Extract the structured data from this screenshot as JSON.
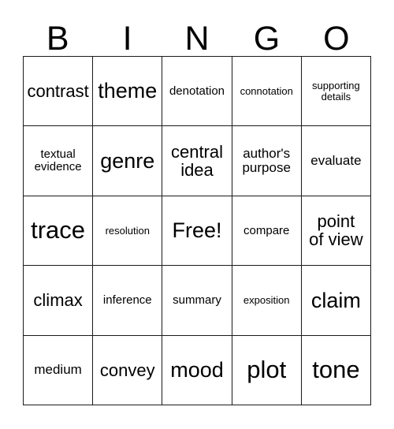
{
  "card": {
    "title": "BINGO",
    "header_letters": [
      "B",
      "I",
      "N",
      "G",
      "O"
    ],
    "columns": 5,
    "rows": 5,
    "free_space_label": "Free!",
    "free_space_position": {
      "row": 3,
      "column": 3
    },
    "colors": {
      "text": "#000000",
      "grid_line": "#1a1a1a",
      "background": "#ffffff"
    },
    "cells": [
      [
        {
          "text": "contrast",
          "size": "md"
        },
        {
          "text": "theme",
          "size": "lg"
        },
        {
          "text": "denotation",
          "size": "xs"
        },
        {
          "text": "connotation",
          "size": "xxs"
        },
        {
          "text": "supporting\ndetails",
          "size": "xxs"
        }
      ],
      [
        {
          "text": "textual\nevidence",
          "size": "xs"
        },
        {
          "text": "genre",
          "size": "lg"
        },
        {
          "text": "central\nidea",
          "size": "md"
        },
        {
          "text": "author's\npurpose",
          "size": "sm"
        },
        {
          "text": "evaluate",
          "size": "sm"
        }
      ],
      [
        {
          "text": "trace",
          "size": "xl"
        },
        {
          "text": "resolution",
          "size": "xxs"
        },
        {
          "text": "Free!",
          "size": "lg"
        },
        {
          "text": "compare",
          "size": "xs"
        },
        {
          "text": "point\nof view",
          "size": "md"
        }
      ],
      [
        {
          "text": "climax",
          "size": "md"
        },
        {
          "text": "inference",
          "size": "xs"
        },
        {
          "text": "summary",
          "size": "xs"
        },
        {
          "text": "exposition",
          "size": "xxs"
        },
        {
          "text": "claim",
          "size": "lg"
        }
      ],
      [
        {
          "text": "medium",
          "size": "sm"
        },
        {
          "text": "convey",
          "size": "md"
        },
        {
          "text": "mood",
          "size": "lg"
        },
        {
          "text": "plot",
          "size": "xl"
        },
        {
          "text": "tone",
          "size": "xl"
        }
      ]
    ]
  }
}
